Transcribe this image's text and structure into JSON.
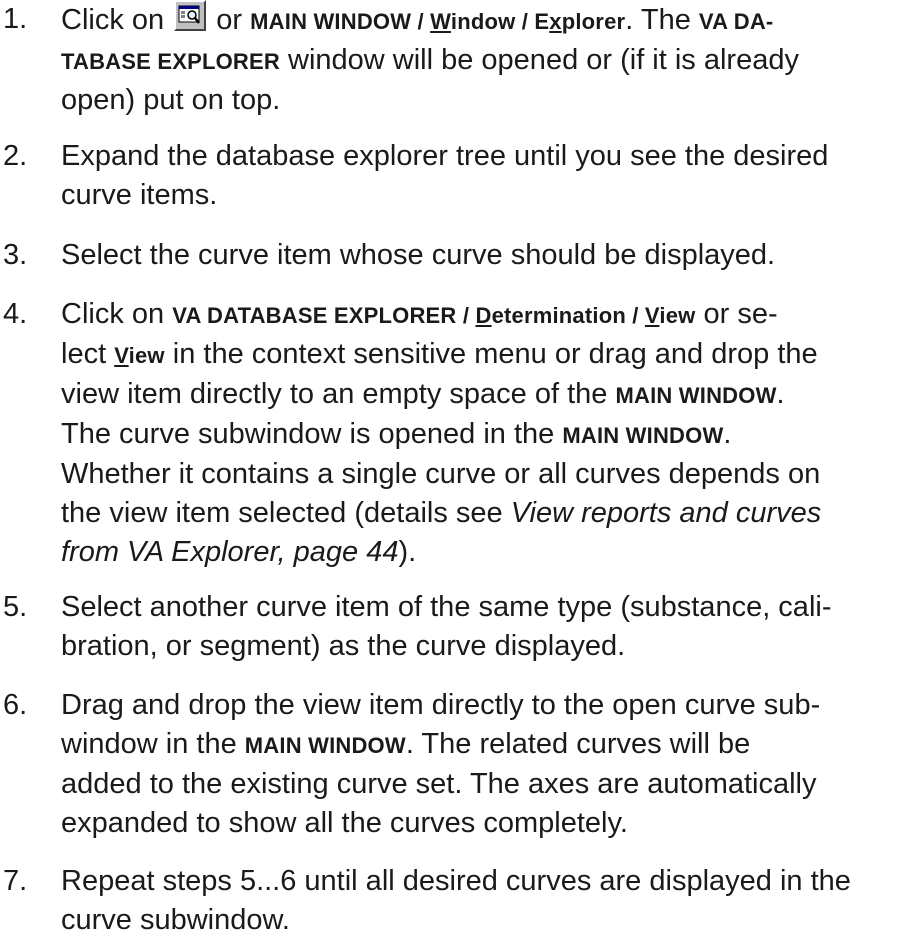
{
  "steps": [
    {
      "number": "1.",
      "line1": [
        "Click on",
        "or",
        "MAIN WINDOW / ",
        "W",
        "indow / E",
        "x",
        "plorer",
        ". The ",
        "VA DA-"
      ],
      "line2": [
        "TABASE EXPLORER",
        " window will be opened or (if it is already"
      ],
      "line3": "open) put on top."
    },
    {
      "number": "2.",
      "line1": "Expand the database explorer tree until you see the desired",
      "line2": "curve items."
    },
    {
      "number": "3.",
      "line1": "Select the curve item whose curve should be displayed."
    },
    {
      "number": "4.",
      "line1": [
        "Click on ",
        "VA DATABASE EXPLORER / ",
        "D",
        "etermination / ",
        "V",
        "iew",
        " or se-"
      ],
      "line2": [
        "lect ",
        "V",
        "iew",
        " in the context sensitive menu or drag and drop the"
      ],
      "line3": [
        "view item directly to an empty space of the ",
        "MAIN WINDOW",
        "."
      ],
      "line4": [
        "The curve subwindow is opened in the ",
        "MAIN WINDOW",
        "."
      ],
      "line5": "Whether it contains a single curve or all curves depends on",
      "line6": [
        "the view item selected (details see ",
        "View reports and curves"
      ],
      "line7": [
        "from VA Explorer, page 44",
        ")."
      ]
    },
    {
      "number": "5.",
      "line1": "Select another curve item of the same type (substance, cali-",
      "line2": "bration, or segment) as the curve displayed."
    },
    {
      "number": "6.",
      "line1": "Drag and drop the view item directly to the open curve sub-",
      "line2": [
        "window in the ",
        "MAIN WINDOW",
        ". The related curves will be"
      ],
      "line3": "added to the existing curve set. The axes are automatically",
      "line4": "expanded to show all the curves completely."
    },
    {
      "number": "7.",
      "line1": "Repeat steps 5...6 until all desired curves are displayed in the",
      "line2": "curve subwindow."
    }
  ],
  "icons": {
    "explorer_button": "explorer-toolbar-icon"
  },
  "colors": {
    "text": "#1a1a1a",
    "background": "#ffffff",
    "icon_face": "#c0c0c0",
    "icon_accent": "#000080"
  }
}
